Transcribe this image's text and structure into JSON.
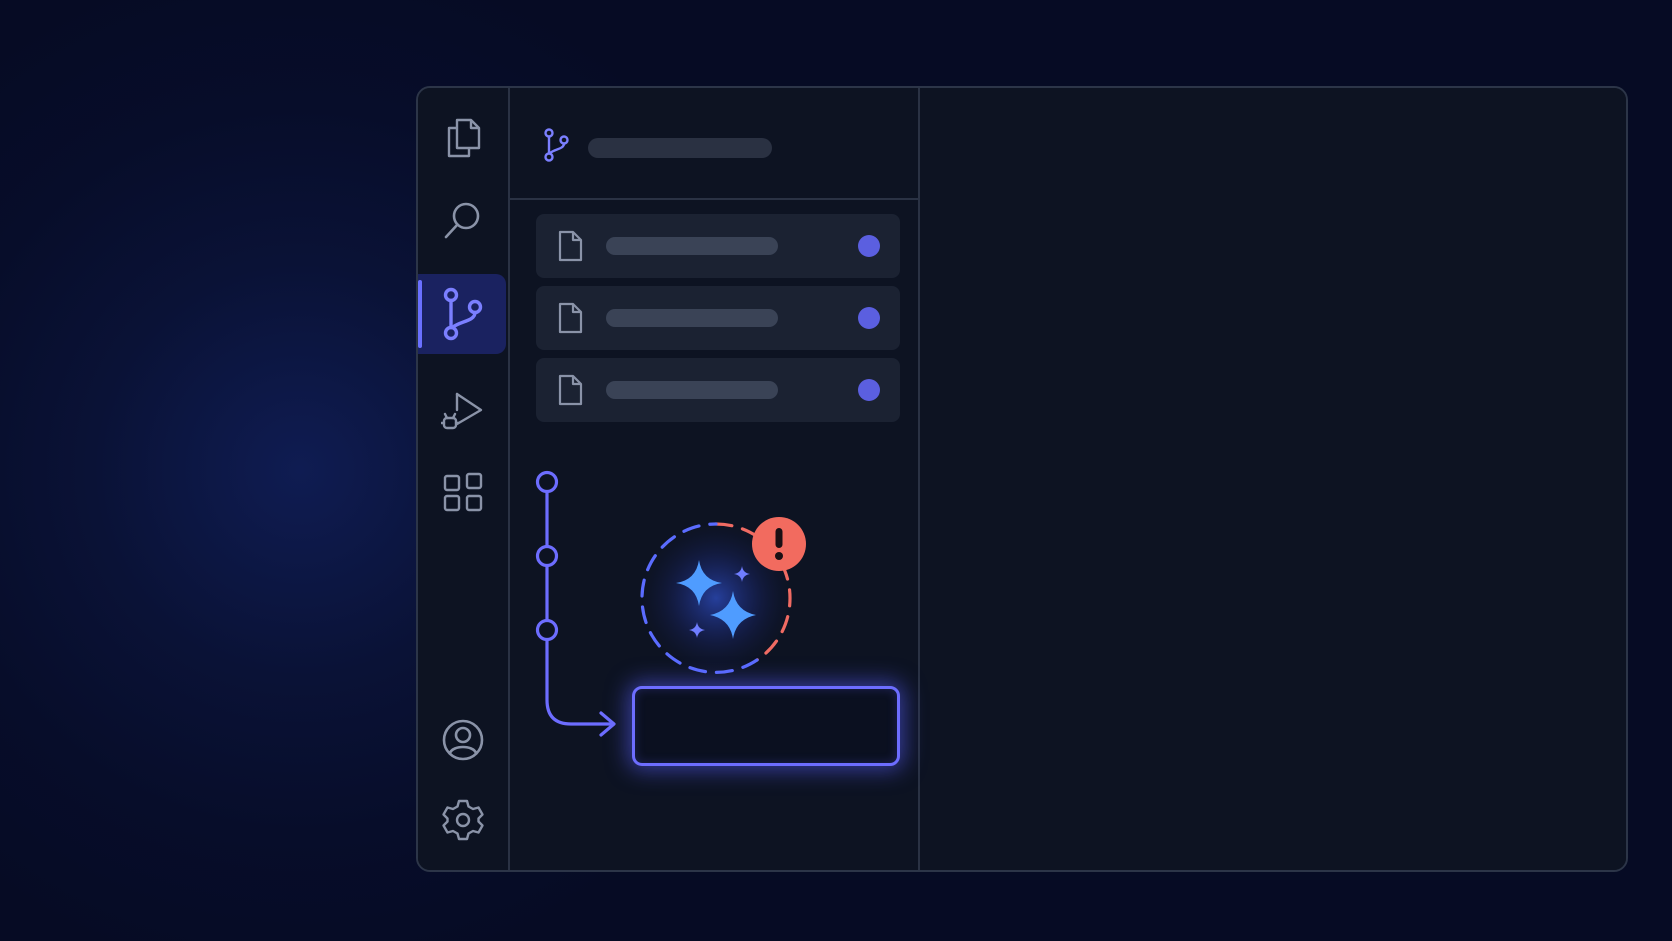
{
  "colors": {
    "background": "#070d2a",
    "window": "#0d1322",
    "border": "#2c3548",
    "accent": "#6a70ff",
    "status_dot": "#5b5fe0",
    "alert": "#f26b5f",
    "sparkle": "#4f9cff"
  },
  "activity_bar": {
    "items": [
      {
        "icon": "files-icon",
        "active": false
      },
      {
        "icon": "search-icon",
        "active": false
      },
      {
        "icon": "source-control-icon",
        "active": true
      },
      {
        "icon": "run-debug-icon",
        "active": false
      },
      {
        "icon": "extensions-icon",
        "active": false
      }
    ],
    "bottom_items": [
      {
        "icon": "account-icon"
      },
      {
        "icon": "settings-icon"
      }
    ]
  },
  "source_control": {
    "header_icon": "branch-icon",
    "changes": [
      {
        "icon": "file-icon",
        "status": "modified"
      },
      {
        "icon": "file-icon",
        "status": "modified"
      },
      {
        "icon": "file-icon",
        "status": "modified"
      }
    ],
    "ai_indicator": {
      "icon": "sparkles-icon",
      "badge_icon": "alert-icon"
    },
    "commit_input": {
      "value": "",
      "placeholder": ""
    }
  }
}
